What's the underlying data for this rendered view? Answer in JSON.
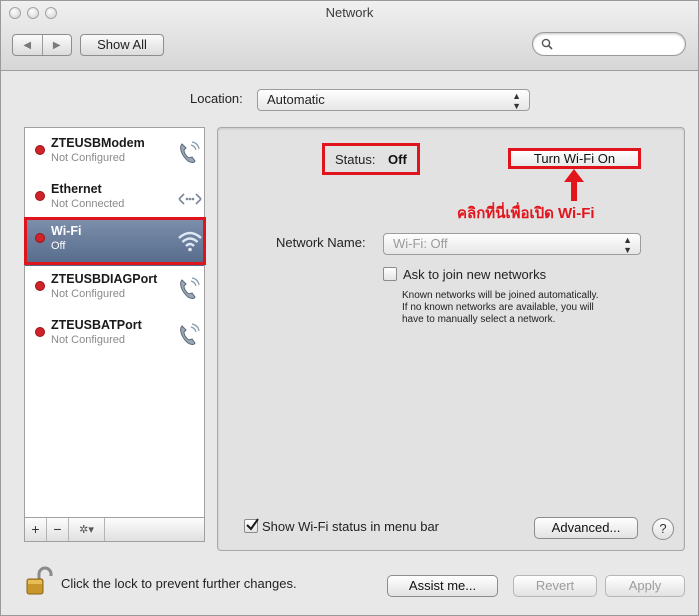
{
  "window": {
    "title": "Network"
  },
  "toolbar": {
    "back_glyph": "◀",
    "forward_glyph": "▶",
    "show_all": "Show All",
    "search_icon": "search-icon"
  },
  "location": {
    "label": "Location:",
    "value": "Automatic"
  },
  "services": [
    {
      "name": "ZTEUSBModem",
      "status": "Not Configured",
      "icon": "phone-icon",
      "indicator": "#d0222a"
    },
    {
      "name": "Ethernet",
      "status": "Not Connected",
      "icon": "ethernet-icon",
      "indicator": "#d0222a"
    },
    {
      "name": "Wi-Fi",
      "status": "Off",
      "icon": "wifi-icon",
      "indicator": "#d0222a",
      "selected": true
    },
    {
      "name": "ZTEUSBDIAGPort",
      "status": "Not Configured",
      "icon": "phone-icon",
      "indicator": "#d0222a"
    },
    {
      "name": "ZTEUSBATPort",
      "status": "Not Configured",
      "icon": "phone-icon",
      "indicator": "#d0222a"
    }
  ],
  "sidebar_toolbar": {
    "add": "+",
    "remove": "−",
    "gear": "✲▾"
  },
  "detail": {
    "status_label": "Status:",
    "status_value": "Off",
    "turn_on_button": "Turn Wi-Fi On",
    "annotation": "คลิกที่นี่เพื่อเปิด Wi-Fi",
    "network_name_label": "Network Name:",
    "network_name_value": "Wi-Fi: Off",
    "ask_join_label": "Ask to join new networks",
    "ask_join_checked": false,
    "help_text_lines": [
      "Known networks will be joined automatically.",
      "If no known networks are available, you will",
      "have to manually select a network."
    ],
    "show_status_label": "Show Wi-Fi status in menu bar",
    "show_status_checked": true,
    "advanced_button": "Advanced...",
    "help_button": "?"
  },
  "footer": {
    "lock_text": "Click the lock to prevent further changes.",
    "assist_button": "Assist me...",
    "revert_button": "Revert",
    "apply_button": "Apply"
  },
  "colors": {
    "highlight_red": "#e0141c",
    "selection": "#5f7393",
    "status_dot": "#d0222a"
  }
}
